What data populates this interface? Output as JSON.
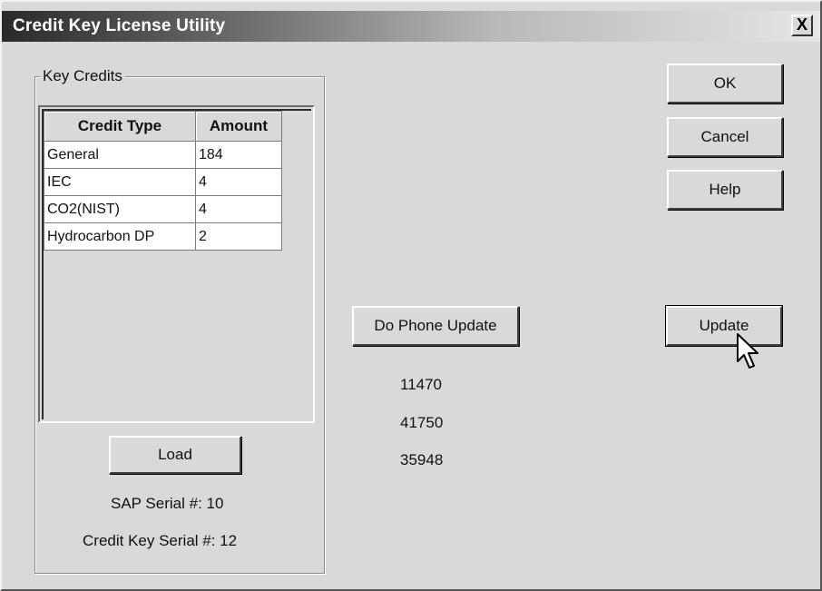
{
  "window": {
    "title": "Credit Key License Utility",
    "close_label": "X"
  },
  "key_credits": {
    "legend": "Key Credits",
    "columns": [
      "Credit Type",
      "Amount"
    ],
    "rows": [
      {
        "type": "General",
        "amount": "184"
      },
      {
        "type": "IEC",
        "amount": "4"
      },
      {
        "type": "CO2(NIST)",
        "amount": "4"
      },
      {
        "type": "Hydrocarbon DP",
        "amount": "2"
      }
    ],
    "load_label": "Load",
    "sap_serial": "SAP Serial #: 10",
    "credit_key_serial": "Credit Key Serial #: 12"
  },
  "buttons": {
    "ok": "OK",
    "cancel": "Cancel",
    "help": "Help",
    "do_phone_update": "Do Phone Update",
    "update": "Update"
  },
  "phone_codes": [
    "11470",
    "41750",
    "35948"
  ],
  "icons": {
    "cursor": "arrow-cursor-icon"
  }
}
